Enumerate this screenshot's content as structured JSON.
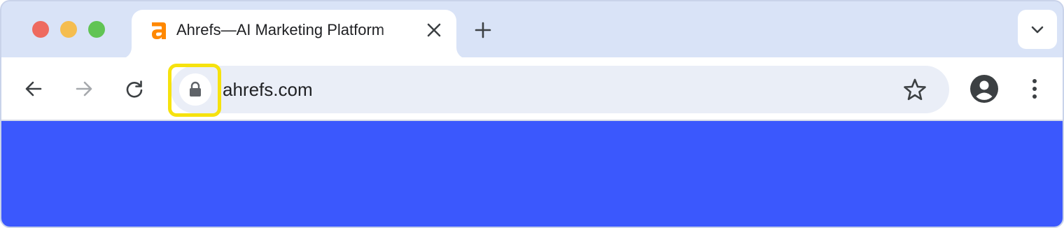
{
  "window": {
    "traffic_lights": {
      "close_color": "#ee6a5f",
      "minimize_color": "#f5bd4f",
      "zoom_color": "#61c454"
    }
  },
  "tab": {
    "title": "Ahrefs—AI Marketing Platform",
    "favicon": "ahrefs-a-logo",
    "favicon_color": "#ff8800",
    "close_icon": "close-icon"
  },
  "tabstrip": {
    "new_tab_icon": "plus-icon",
    "tab_search_icon": "chevron-down-icon"
  },
  "toolbar": {
    "back_icon": "arrow-left-icon",
    "forward_icon": "arrow-right-icon",
    "reload_icon": "reload-icon",
    "site_info_icon": "lock-icon",
    "url": "ahrefs.com",
    "bookmark_icon": "star-icon",
    "profile_icon": "account-circle-icon",
    "menu_icon": "three-dots-vertical-icon"
  },
  "highlight_color": "#f6e20e",
  "page_background": "#3b58fd"
}
